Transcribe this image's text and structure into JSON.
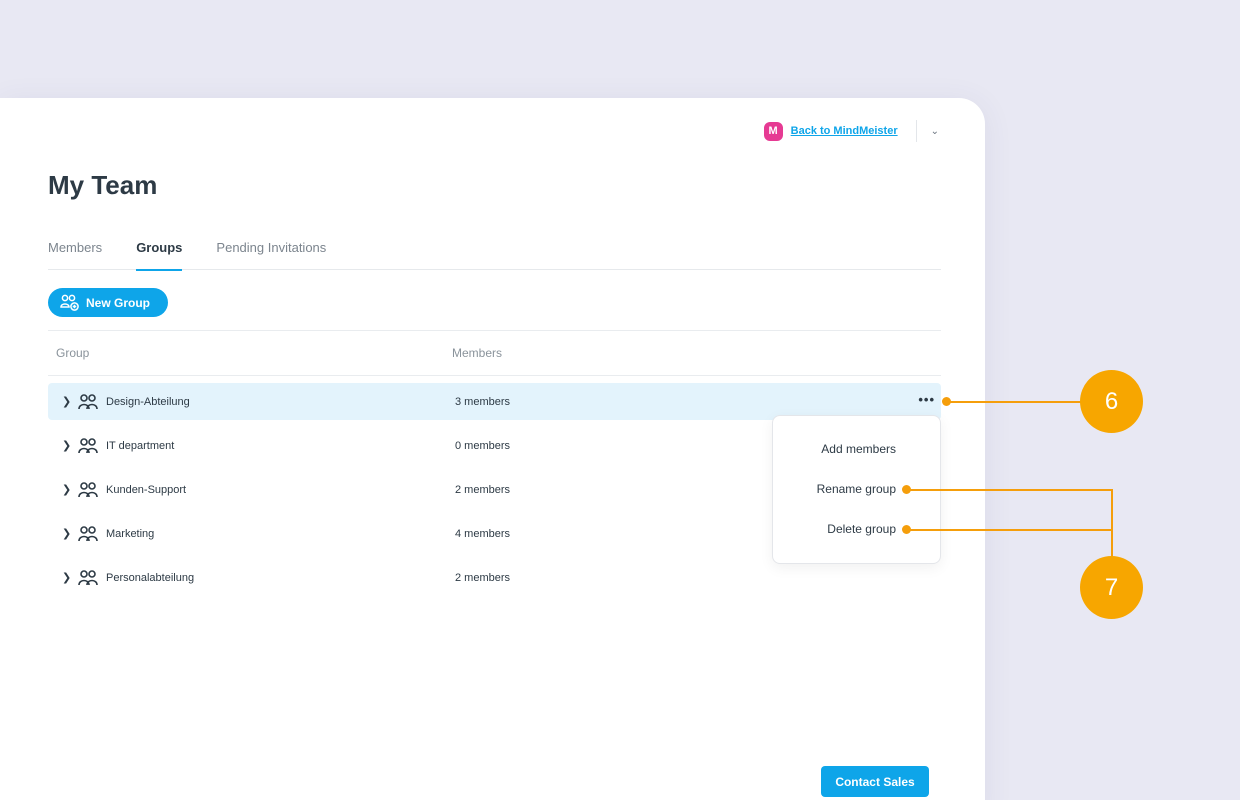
{
  "header": {
    "logo_letter": "M",
    "back_link": "Back to MindMeister",
    "menu_chevron": "⌄"
  },
  "page": {
    "title": "My Team"
  },
  "tabs": [
    {
      "label": "Members",
      "active": false
    },
    {
      "label": "Groups",
      "active": true
    },
    {
      "label": "Pending Invitations",
      "active": false
    }
  ],
  "new_group_label": "New Group",
  "table": {
    "headers": [
      "Group",
      "Members"
    ],
    "rows": [
      {
        "name": "Design-Abteilung",
        "members": "3 members",
        "highlighted": true
      },
      {
        "name": "IT department",
        "members": "0 members"
      },
      {
        "name": "Kunden-Support",
        "members": "2 members"
      },
      {
        "name": "Marketing",
        "members": "4 members"
      },
      {
        "name": "Personalabteilung",
        "members": "2 members"
      }
    ],
    "more_icon": "•••"
  },
  "context_menu": {
    "items": [
      "Add members",
      "Rename group",
      "Delete group"
    ]
  },
  "contact_sales_label": "Contact Sales",
  "annotations": {
    "callout_6": "6",
    "callout_7": "7"
  },
  "colors": {
    "accent": "#0ea5e9",
    "brand_logo": "#e63a93",
    "annotation": "#f7a600",
    "row_highlight": "#e3f3fc"
  }
}
